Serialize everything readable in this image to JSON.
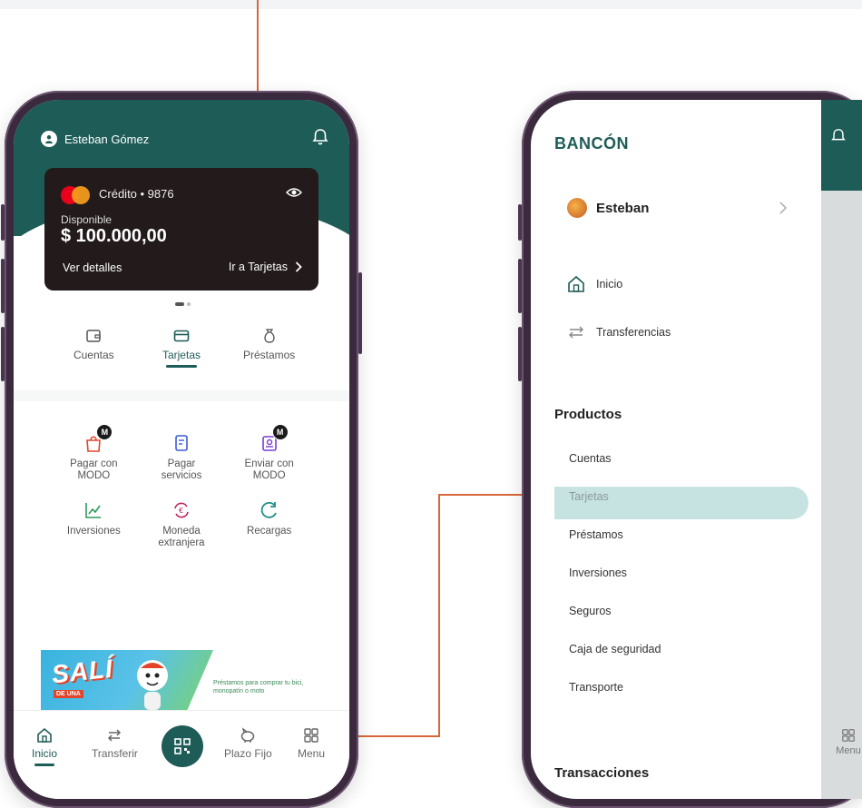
{
  "left_phone": {
    "user_name": "Esteban Gómez",
    "card": {
      "type_label": "Crédito • 9876",
      "available_label": "Disponible",
      "balance": "$ 100.000,00",
      "details_link": "Ver detalles",
      "cards_link": "Ir a Tarjetas"
    },
    "tabs": [
      {
        "label": "Cuentas",
        "icon": "wallet-icon"
      },
      {
        "label": "Tarjetas",
        "icon": "card-icon",
        "active": true
      },
      {
        "label": "Préstamos",
        "icon": "money-bag-icon"
      }
    ],
    "actions": [
      {
        "label": "Pagar con MODO",
        "icon": "shopping-bag-icon",
        "badge": "M"
      },
      {
        "label": "Pagar servicios",
        "icon": "receipt-icon"
      },
      {
        "label": "Enviar con MODO",
        "icon": "send-money-icon",
        "badge": "M"
      },
      {
        "label": "Inversiones",
        "icon": "chart-icon"
      },
      {
        "label": "Moneda extranjera",
        "icon": "currency-exchange-icon"
      },
      {
        "label": "Recargas",
        "icon": "refresh-icon"
      }
    ],
    "banner": {
      "title": "SALÍ",
      "subtitle": "DE UNA",
      "text": "Préstamos para comprar tu bici, monopatín o moto"
    },
    "bottom_nav": [
      {
        "label": "Inicio",
        "icon": "home-icon",
        "active": true
      },
      {
        "label": "Transferir",
        "icon": "transfer-icon"
      },
      {
        "label": "",
        "icon": "qr-icon"
      },
      {
        "label": "Plazo Fijo",
        "icon": "piggy-bank-icon"
      },
      {
        "label": "Menu",
        "icon": "grid-icon"
      }
    ]
  },
  "right_phone": {
    "logo": "BANCÓN",
    "user_name": "Esteban",
    "main_items": [
      {
        "label": "Inicio",
        "icon": "home-icon"
      },
      {
        "label": "Transferencias",
        "icon": "transfer-icon"
      }
    ],
    "products_heading": "Productos",
    "products": [
      "Cuentas",
      "Tarjetas",
      "Préstamos",
      "Inversiones",
      "Seguros",
      "Caja de seguridad",
      "Transporte"
    ],
    "selected_product": "Tarjetas",
    "transactions_heading": "Transacciones",
    "peek_menu_label": "Menu"
  },
  "colors": {
    "brand": "#1e5c57",
    "accent_line": "#d8663a",
    "highlight": "#c6e3e1",
    "card_bg": "#221a1b"
  }
}
